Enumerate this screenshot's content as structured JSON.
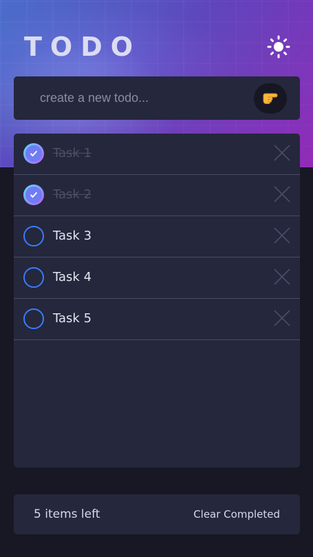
{
  "app": {
    "title": "TODO"
  },
  "header": {
    "theme_icon": "sun-icon",
    "add_icon": "pointing-hand-icon"
  },
  "new_todo": {
    "placeholder": "create a new todo..."
  },
  "todos": [
    {
      "label": "Task 1",
      "completed": true
    },
    {
      "label": "Task 2",
      "completed": true
    },
    {
      "label": "Task 3",
      "completed": false
    },
    {
      "label": "Task 4",
      "completed": false
    },
    {
      "label": "Task 5",
      "completed": false
    }
  ],
  "footer": {
    "items_left": "5 items left",
    "clear_label": "Clear Completed"
  },
  "colors": {
    "background": "#181824",
    "card": "#25273c",
    "check_border": "#3a7bfd",
    "check_gradient_start": "#57ddff",
    "check_gradient_end": "#c058f3"
  }
}
